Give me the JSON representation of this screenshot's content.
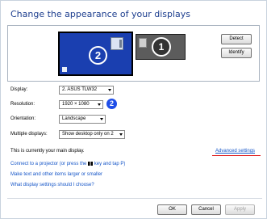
{
  "window": {
    "title": "Change the appearance of your displays"
  },
  "arrangement": {
    "monitor_primary_number": "2",
    "monitor_secondary_number": "1",
    "detect_label": "Detect",
    "identify_label": "Identify"
  },
  "form": {
    "display_label": "Display:",
    "display_value": "2. ASUS TLW32",
    "resolution_label": "Resolution:",
    "resolution_value": "1920 × 1080",
    "resolution_badge": "2",
    "orientation_label": "Orientation:",
    "orientation_value": "Landscape",
    "multiple_label": "Multiple displays:",
    "multiple_value": "Show desktop only on 2"
  },
  "status": {
    "main_display_text": "This is currently your main display."
  },
  "links": {
    "advanced": "Advanced settings",
    "projector_prefix": "Connect to a projector (or press the",
    "projector_suffix": "key and tap P)",
    "text_size": "Make text and other items larger or smaller",
    "which_settings": "What display settings should I choose?"
  },
  "footer": {
    "ok_label": "OK",
    "cancel_label": "Cancel",
    "apply_label": "Apply"
  },
  "colors": {
    "accent": "#1e3f8f",
    "link": "#1656c8",
    "badge": "#1f4ee8",
    "underline": "#e02020"
  },
  "icons": {
    "windows_key": "windows-logo-icon"
  }
}
